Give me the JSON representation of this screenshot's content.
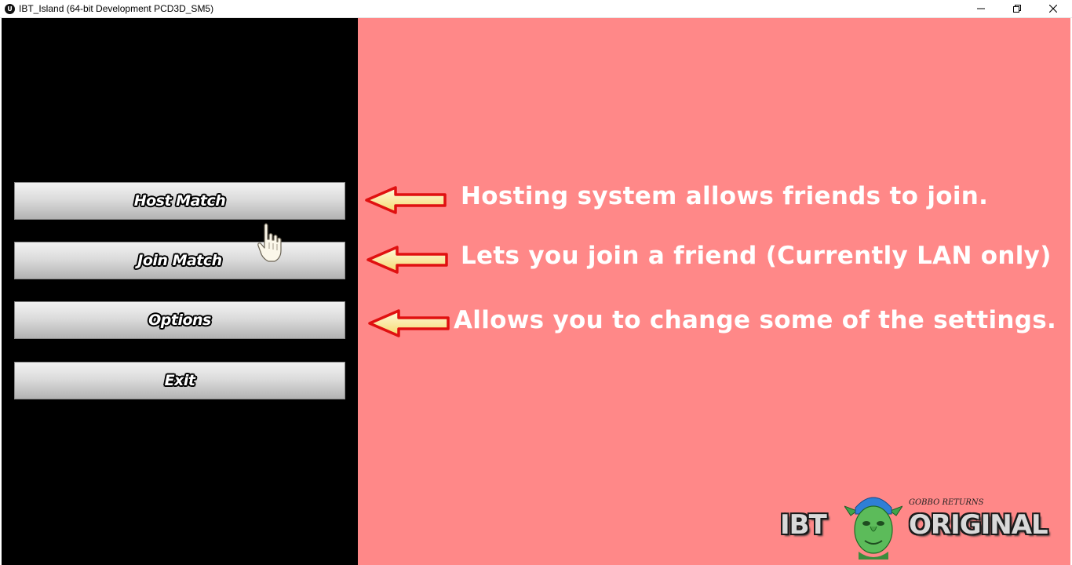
{
  "window": {
    "title": "IBT_Island (64-bit Development PCD3D_SM5)",
    "app_icon": "unreal-engine-icon",
    "icon_letter": "U",
    "controls": [
      "minimize-icon",
      "restore-icon",
      "close-icon"
    ]
  },
  "menu": {
    "buttons": [
      {
        "label": "Host Match"
      },
      {
        "label": "Join Match"
      },
      {
        "label": "Options"
      },
      {
        "label": "Exit"
      }
    ]
  },
  "info": {
    "lines": [
      {
        "icon": "left-arrow-icon",
        "text": "Hosting system allows friends to join."
      },
      {
        "icon": "left-arrow-icon",
        "text": "Lets you join a friend (Currently LAN only)"
      },
      {
        "icon": "left-arrow-icon",
        "text": "Allows you to change some of the settings."
      }
    ]
  },
  "logo": {
    "left_word": "IBT",
    "right_word": "ORIGINAL",
    "tagline": "GOBBO RETURNS",
    "mascot": "goblin-face-icon"
  },
  "colors": {
    "info_background": "#ff8888",
    "menu_background": "#000000",
    "arrow_outline": "#e01010",
    "arrow_fill": "#fff0b0"
  },
  "cursor": "hand-pointer-icon"
}
